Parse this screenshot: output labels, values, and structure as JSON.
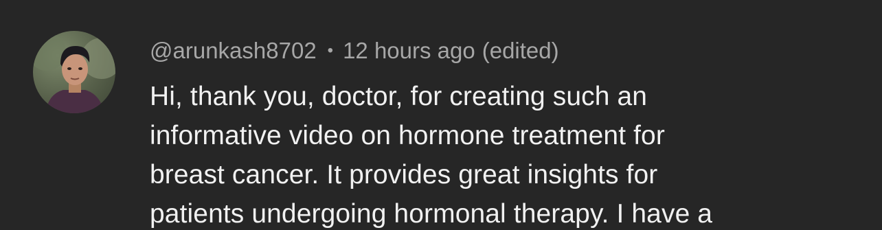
{
  "comment": {
    "author": "@arunkash8702",
    "separator": "•",
    "time_ago": "12 hours ago",
    "edited_label": "(edited)",
    "text_lines": [
      "Hi, thank you, doctor, for creating such an",
      "informative video on hormone treatment for",
      "breast cancer. It provides great insights for",
      "patients undergoing hormonal therapy. I have a"
    ]
  },
  "colors": {
    "background": "#262626",
    "meta_text": "#a7a7a7",
    "body_text": "#f1f1f1"
  },
  "icons": {
    "avatar": "user-avatar-photo"
  }
}
